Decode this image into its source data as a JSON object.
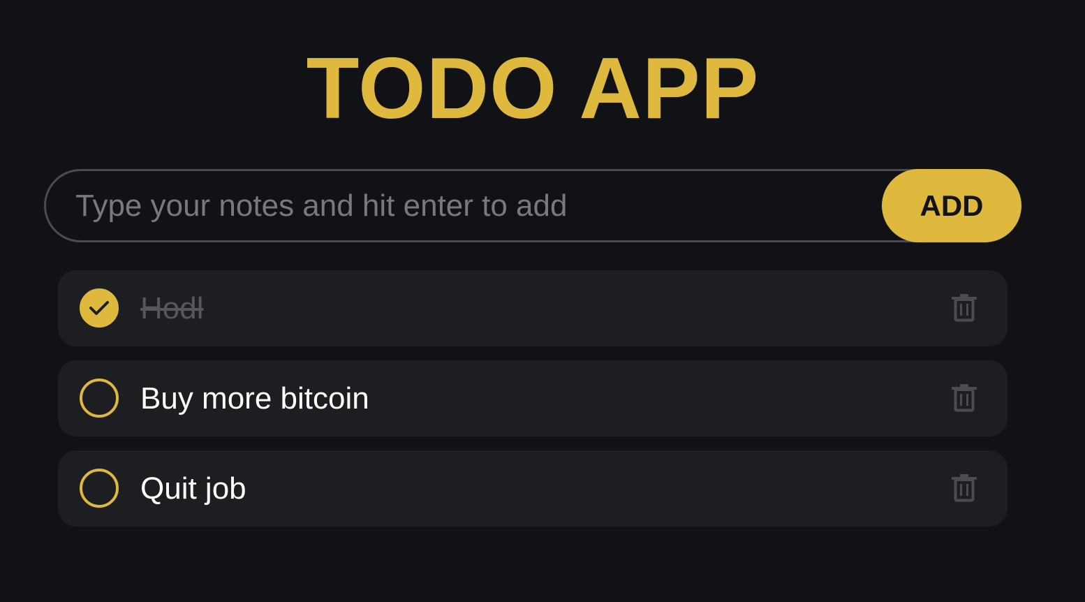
{
  "app": {
    "title": "TODO APP",
    "accent_color": "#dfb93d",
    "background_color": "#111215"
  },
  "input": {
    "placeholder": "Type your notes and hit enter to add",
    "value": ""
  },
  "add_button": {
    "label": "ADD"
  },
  "todos": [
    {
      "text": "Hodl",
      "completed": true,
      "check_icon": "check-icon",
      "delete_icon": "trash-icon"
    },
    {
      "text": "Buy more bitcoin",
      "completed": false,
      "check_icon": "circle-icon",
      "delete_icon": "trash-icon"
    },
    {
      "text": "Quit job",
      "completed": false,
      "check_icon": "circle-icon",
      "delete_icon": "trash-icon"
    }
  ]
}
